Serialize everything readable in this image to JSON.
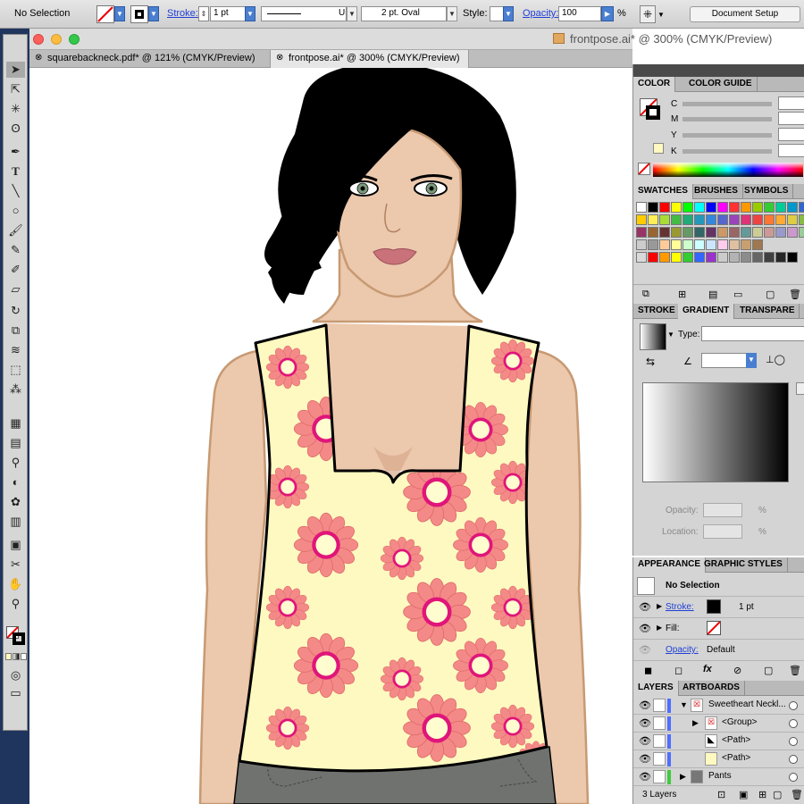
{
  "control_bar": {
    "selection": "No Selection",
    "stroke_label": "Stroke:",
    "stroke_weight": "1 pt",
    "profile": "Uniform",
    "brush": "2 pt. Oval",
    "style_label": "Style:",
    "opacity_label": "Opacity:",
    "opacity_value": "100",
    "opacity_unit": "%",
    "document_setup": "Document Setup"
  },
  "window": {
    "title": "frontpose.ai* @ 300% (CMYK/Preview)"
  },
  "tabs": [
    {
      "label": "squarebackneck.pdf* @ 121% (CMYK/Preview)"
    },
    {
      "label": "frontpose.ai* @ 300% (CMYK/Preview)"
    }
  ],
  "tools": [
    "selection-icon",
    "direct-selection-icon",
    "magic-wand-icon",
    "lasso-icon",
    "pen-icon",
    "type-icon",
    "line-icon",
    "ellipse-icon",
    "paintbrush-icon",
    "pencil-icon",
    "blob-brush-icon",
    "eraser-icon",
    "rotate-icon",
    "scale-icon",
    "warp-icon",
    "free-transform-icon",
    "symbol-sprayer-icon",
    "mesh-icon",
    "gradient-icon",
    "eyedropper-icon",
    "blend-icon",
    "graph-icon",
    "artboard-icon",
    "slice-icon",
    "hand-icon",
    "zoom-icon"
  ],
  "color_panel": {
    "tabs": [
      "COLOR",
      "COLOR GUIDE"
    ],
    "channels": [
      "C",
      "M",
      "Y",
      "K"
    ]
  },
  "swatches_panel": {
    "tabs": [
      "SWATCHES",
      "BRUSHES",
      "SYMBOLS"
    ],
    "rows": [
      [
        "#ffffff",
        "#000000",
        "#ff0000",
        "#ffff00",
        "#00ff00",
        "#00ffff",
        "#0000ff",
        "#ff00ff",
        "#ff3333",
        "#ff9900",
        "#99cc00",
        "#33cc33",
        "#00cc99",
        "#0099cc",
        "#3366cc",
        "#cc3399",
        "#cc0033"
      ],
      [
        "#ffcc00",
        "#ffee55",
        "#aadd33",
        "#44bb44",
        "#22aa77",
        "#2299bb",
        "#3388dd",
        "#5566cc",
        "#9944bb",
        "#dd3377",
        "#ee4444",
        "#ff7733",
        "#ffaa33",
        "#ddcc44",
        "#88bb44",
        "#44aa88",
        "#4477cc"
      ],
      [
        "#993366",
        "#996633",
        "#663333",
        "#999933",
        "#669966",
        "#336666",
        "#663366",
        "#cc9966",
        "#996666",
        "#669999",
        "#cccc99",
        "#cc9999",
        "#9999cc",
        "#cc99cc",
        "#99cc99",
        "#666699",
        "#996699"
      ],
      [
        "#cccccc",
        "#999999",
        "#ffcc99",
        "#ffff99",
        "#ccffcc",
        "#ccffff",
        "#cce5ff",
        "#ffccee",
        "#e0c0a0",
        "#c8a070",
        "#a07850"
      ],
      [
        "#d9d9d9",
        "#ff0000",
        "#ff9900",
        "#ffff00",
        "#33cc33",
        "#3366ff",
        "#9933cc",
        "#cccccc",
        "#b3b3b3",
        "#8c8c8c",
        "#666666",
        "#404040",
        "#262626",
        "#000000"
      ]
    ]
  },
  "gradient_panel": {
    "tabs": [
      "STROKE",
      "GRADIENT",
      "TRANSPARE"
    ],
    "type_label": "Type:",
    "opacity_label": "Opacity:",
    "location_label": "Location:",
    "unit": "%"
  },
  "appearance_panel": {
    "tabs": [
      "APPEARANCE",
      "GRAPHIC STYLES"
    ],
    "title": "No Selection",
    "stroke_label": "Stroke:",
    "stroke_value": "1 pt",
    "fill_label": "Fill:",
    "opacity_label": "Opacity:",
    "opacity_value": "Default"
  },
  "layers_panel": {
    "tabs": [
      "LAYERS",
      "ARTBOARDS"
    ],
    "layers": [
      {
        "name": "Sweetheart Neckl...",
        "color": "#4f6fff"
      },
      {
        "name": "<Group>",
        "color": "#4f6fff"
      },
      {
        "name": "<Path>",
        "color": "#4f6fff"
      },
      {
        "name": "<Path>",
        "color": "#4f6fff"
      },
      {
        "name": "Pants",
        "color": "#3ecc3e"
      }
    ],
    "count": "3 Layers"
  }
}
